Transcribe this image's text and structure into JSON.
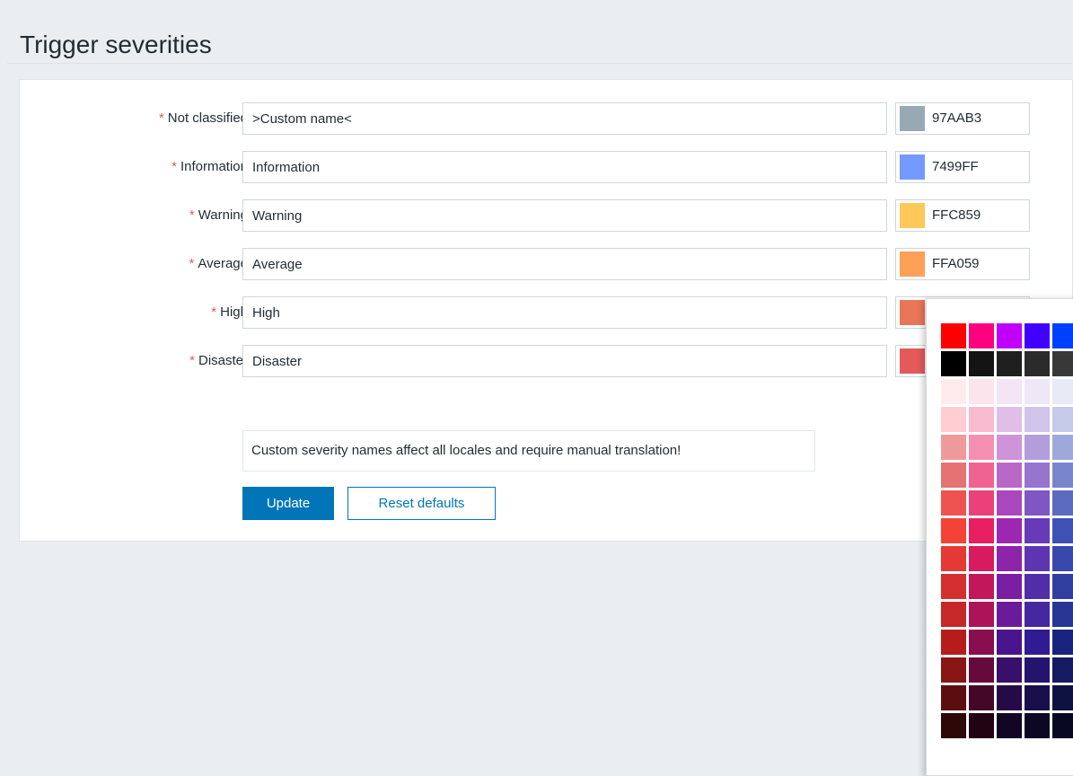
{
  "page": {
    "title": "Trigger severities"
  },
  "severities": [
    {
      "label": "Not classified",
      "name": ">Custom name<",
      "color_code": "97AAB3",
      "swatch": "#97AAB3"
    },
    {
      "label": "Information",
      "name": "Information",
      "color_code": "7499FF",
      "swatch": "#7499FF"
    },
    {
      "label": "Warning",
      "name": "Warning",
      "color_code": "FFC859",
      "swatch": "#FFC859"
    },
    {
      "label": "Average",
      "name": "Average",
      "color_code": "FFA059",
      "swatch": "#FFA059"
    },
    {
      "label": "High",
      "name": "High",
      "color_code": "",
      "swatch": "#E97659"
    },
    {
      "label": "Disaster",
      "name": "Disaster",
      "color_code": "",
      "swatch": "#E45959"
    }
  ],
  "required_marker": "*",
  "notice": "Custom severity names affect all locales and require manual translation!",
  "buttons": {
    "update": "Update",
    "reset": "Reset defaults"
  },
  "color_picker": {
    "palette": [
      [
        "#FF0000",
        "#FF0080",
        "#BF00FF",
        "#4000FF",
        "#0040FF"
      ],
      [
        "#000000",
        "#141414",
        "#1F1F1F",
        "#2B2B2B",
        "#383838"
      ],
      [
        "#FFEBEE",
        "#FCE4EC",
        "#F3E5F5",
        "#EDE7F6",
        "#E8EAF6"
      ],
      [
        "#FFCDD2",
        "#F8BBD0",
        "#E1BEE7",
        "#D1C4E9",
        "#C5CAE9"
      ],
      [
        "#EF9A9A",
        "#F48FB1",
        "#CE93D8",
        "#B39DDB",
        "#9FA8DA"
      ],
      [
        "#E57373",
        "#F06292",
        "#BA68C8",
        "#9575CD",
        "#7986CB"
      ],
      [
        "#EF5350",
        "#EC407A",
        "#AB47BC",
        "#7E57C2",
        "#5C6BC0"
      ],
      [
        "#F44336",
        "#E91E63",
        "#9C27B0",
        "#673AB7",
        "#3F51B5"
      ],
      [
        "#E53935",
        "#D81B60",
        "#8E24AA",
        "#5E35B1",
        "#3949AB"
      ],
      [
        "#D32F2F",
        "#C2185B",
        "#7B1FA2",
        "#512DA8",
        "#303F9F"
      ],
      [
        "#C62828",
        "#AD1457",
        "#6A1B9A",
        "#4527A0",
        "#283593"
      ],
      [
        "#B71C1C",
        "#880E4F",
        "#4A148C",
        "#311B92",
        "#1A237E"
      ],
      [
        "#891515",
        "#660A3C",
        "#380F6A",
        "#25146E",
        "#141B60"
      ],
      [
        "#5C0E0E",
        "#440728",
        "#250A47",
        "#190E4A",
        "#0D1240"
      ],
      [
        "#2E0707",
        "#220314",
        "#130524",
        "#0C0725",
        "#070920"
      ]
    ]
  }
}
